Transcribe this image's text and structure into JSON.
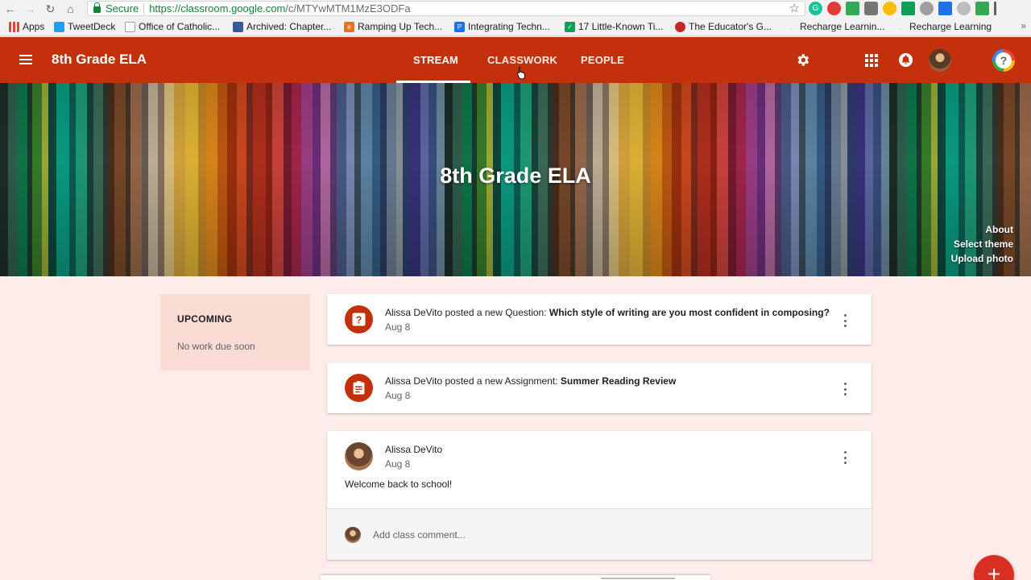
{
  "browser": {
    "secure_label": "Secure",
    "url_host": "https://classroom.google.com",
    "url_path": "/c/MTYwMTM1MzE3ODFa",
    "bookmarks": [
      {
        "label": "Apps",
        "color": "#4285f4"
      },
      {
        "label": "TweetDeck",
        "color": "#1da1f2"
      },
      {
        "label": "Office of Catholic...",
        "color": "#9e9e9e"
      },
      {
        "label": "Archived: Chapter...",
        "color": "#3b5998"
      },
      {
        "label": "Ramping Up Tech...",
        "color": "#e8711c"
      },
      {
        "label": "Integrating Techn...",
        "color": "#1a73e8"
      },
      {
        "label": "17 Little-Known Ti...",
        "color": "#0f9d58"
      },
      {
        "label": "The Educator's G...",
        "color": "#c62828"
      },
      {
        "label": "Recharge Learnin...",
        "color": "#9e9e9e"
      },
      {
        "label": "Recharge Learning",
        "color": "#9e9e9e"
      }
    ],
    "more_bookmarks": "»"
  },
  "header": {
    "class_title": "8th Grade ELA",
    "tabs": [
      {
        "label": "STREAM",
        "active": true
      },
      {
        "label": "CLASSWORK",
        "active": false
      },
      {
        "label": "PEOPLE",
        "active": false
      }
    ],
    "accent": "#c2310c",
    "help_glyph": "?"
  },
  "banner": {
    "title": "8th Grade ELA",
    "links": [
      "About",
      "Select theme",
      "Upload photo"
    ]
  },
  "upcoming": {
    "title": "UPCOMING",
    "empty_text": "No work due soon"
  },
  "stream": [
    {
      "type": "question",
      "icon": "question-icon",
      "prefix": "Alissa DeVito posted a new Question: ",
      "title": "Which style of writing are you most confident in composing?",
      "date": "Aug 8"
    },
    {
      "type": "assignment",
      "icon": "assignment-icon",
      "prefix": "Alissa DeVito posted a new Assignment: ",
      "title": "Summer Reading Review",
      "date": "Aug 8"
    },
    {
      "type": "announcement",
      "author": "Alissa DeVito",
      "date": "Aug 8",
      "body": "Welcome back to school!",
      "comment_placeholder": "Add class comment..."
    }
  ],
  "fab_label": "+"
}
